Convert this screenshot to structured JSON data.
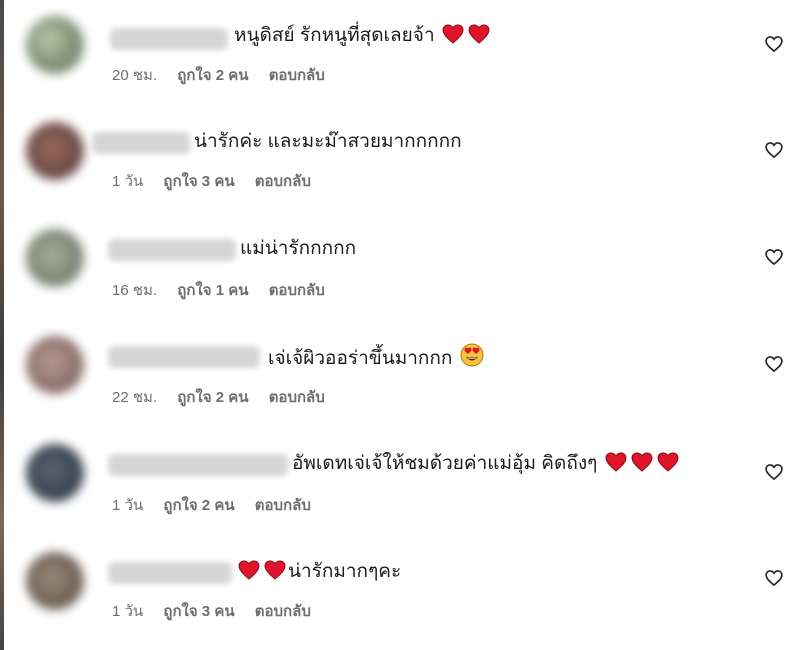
{
  "comments": [
    {
      "text": "หนูดิสย์ รักหนูที่สุดเลยจ้า",
      "time": "20 ชม.",
      "likes": "ถูกใจ 2 คน",
      "reply": "ตอบกลับ",
      "trailing_hearts": 2,
      "leading_hearts": 0,
      "emoji": ""
    },
    {
      "text": "น่ารักค่ะ และมะม๊าสวยมากกกกก",
      "time": "1 วัน",
      "likes": "ถูกใจ 3 คน",
      "reply": "ตอบกลับ",
      "trailing_hearts": 0,
      "leading_hearts": 0,
      "emoji": ""
    },
    {
      "text": "แม่น่ารักกกกก",
      "time": "16 ชม.",
      "likes": "ถูกใจ 1 คน",
      "reply": "ตอบกลับ",
      "trailing_hearts": 0,
      "leading_hearts": 0,
      "emoji": ""
    },
    {
      "text": "เจ่เจ้ผิวออร่าขึ้นมากกก",
      "time": "22 ชม.",
      "likes": "ถูกใจ 2 คน",
      "reply": "ตอบกลับ",
      "trailing_hearts": 0,
      "leading_hearts": 0,
      "emoji": "heart-eyes-emoji"
    },
    {
      "text": "อัพเดทเจ่เจ้ให้ชมด้วยค่าแม่อุ้ม คิดถึงๆ",
      "time": "1 วัน",
      "likes": "ถูกใจ 2 คน",
      "reply": "ตอบกลับ",
      "trailing_hearts": 3,
      "leading_hearts": 0,
      "emoji": ""
    },
    {
      "text": "น่ารักมากๆคะ",
      "time": "1 วัน",
      "likes": "ถูกใจ 3 คน",
      "reply": "ตอบกลับ",
      "trailing_hearts": 0,
      "leading_hearts": 2,
      "emoji": ""
    }
  ],
  "icons": {
    "like": "heart-outline-icon",
    "heart_emoji": "red-heart-emoji"
  },
  "colors": {
    "text": "#1a1a1a",
    "meta": "#6e6e6e",
    "heart": "#e0152c"
  }
}
